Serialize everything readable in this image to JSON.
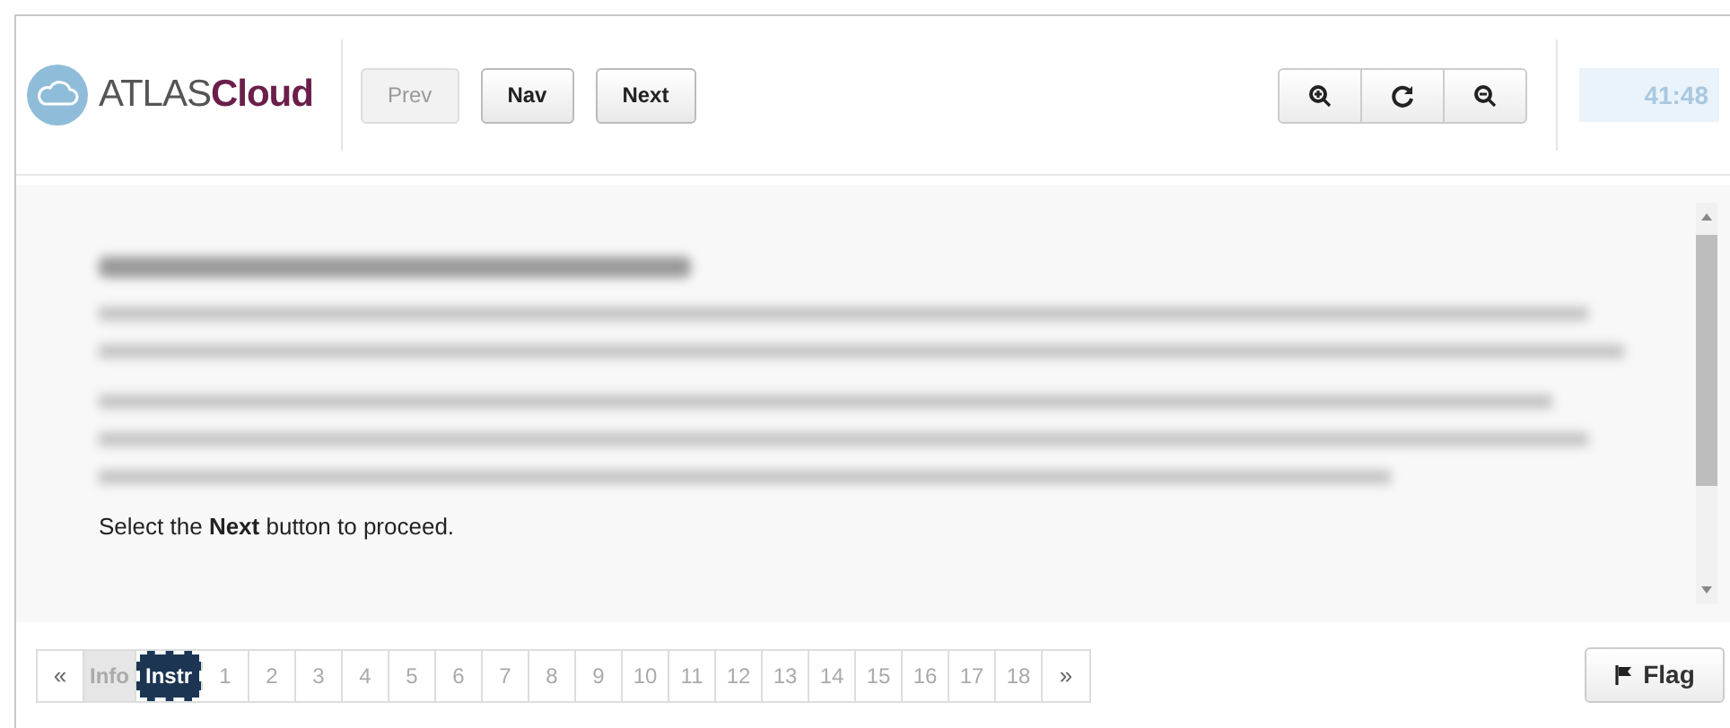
{
  "header": {
    "logo": {
      "brand": "ATLAS",
      "product": "Cloud"
    },
    "buttons": [
      {
        "label": "Prev",
        "disabled": true
      },
      {
        "label": "Nav",
        "disabled": false
      },
      {
        "label": "Next",
        "disabled": false
      }
    ],
    "timer": "41:48"
  },
  "content": {
    "instruction": "Select the **Next** button to proceed."
  },
  "pagination": {
    "first": "«",
    "last": "»",
    "items": [
      {
        "label": "Info",
        "selected": false,
        "disabled": true
      },
      {
        "label": "Instr",
        "selected": true,
        "disabled": false
      },
      {
        "label": "1",
        "selected": false,
        "disabled": false
      },
      {
        "label": "2",
        "selected": false,
        "disabled": false
      },
      {
        "label": "3",
        "selected": false,
        "disabled": false
      },
      {
        "label": "4",
        "selected": false,
        "disabled": false
      },
      {
        "label": "5",
        "selected": false,
        "disabled": false
      },
      {
        "label": "6",
        "selected": false,
        "disabled": false
      },
      {
        "label": "7",
        "selected": false,
        "disabled": false
      },
      {
        "label": "8",
        "selected": false,
        "disabled": false
      },
      {
        "label": "9",
        "selected": false,
        "disabled": false
      },
      {
        "label": "10",
        "selected": false,
        "disabled": false
      },
      {
        "label": "11",
        "selected": false,
        "disabled": false
      },
      {
        "label": "12",
        "selected": false,
        "disabled": false
      },
      {
        "label": "13",
        "selected": false,
        "disabled": false
      },
      {
        "label": "14",
        "selected": false,
        "disabled": false
      },
      {
        "label": "15",
        "selected": false,
        "disabled": false
      },
      {
        "label": "16",
        "selected": false,
        "disabled": false
      },
      {
        "label": "17",
        "selected": false,
        "disabled": false
      },
      {
        "label": "18",
        "selected": false,
        "disabled": false
      }
    ]
  },
  "flag_button": "Flag"
}
